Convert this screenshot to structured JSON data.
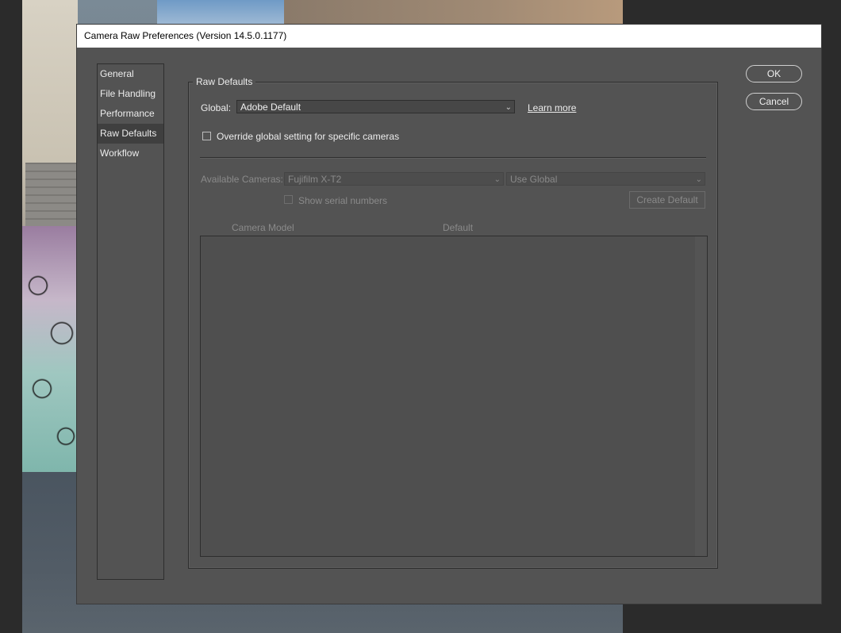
{
  "dialog": {
    "title": "Camera Raw Preferences  (Version 14.5.0.1177)"
  },
  "nav": {
    "items": [
      {
        "label": "General"
      },
      {
        "label": "File Handling"
      },
      {
        "label": "Performance"
      },
      {
        "label": "Raw Defaults",
        "selected": true
      },
      {
        "label": "Workflow"
      }
    ]
  },
  "raw_defaults": {
    "group_title": "Raw Defaults",
    "global_label": "Global:",
    "global_value": "Adobe Default",
    "learn_more": "Learn more",
    "override_label": "Override global setting for specific cameras",
    "override_checked": false,
    "available_cameras_label": "Available Cameras:",
    "camera_value": "Fujifilm X-T2",
    "camera_setting_value": "Use Global",
    "show_serial_label": "Show serial numbers",
    "show_serial_checked": false,
    "create_default_label": "Create Default",
    "table": {
      "columns": [
        "Camera Model",
        "Default"
      ],
      "rows": []
    }
  },
  "buttons": {
    "ok": "OK",
    "cancel": "Cancel"
  },
  "colors": {
    "dialog_bg": "#535353",
    "selected_nav_bg": "#3f3f3f",
    "text": "#ececec",
    "disabled_text": "#8a8a8a"
  }
}
